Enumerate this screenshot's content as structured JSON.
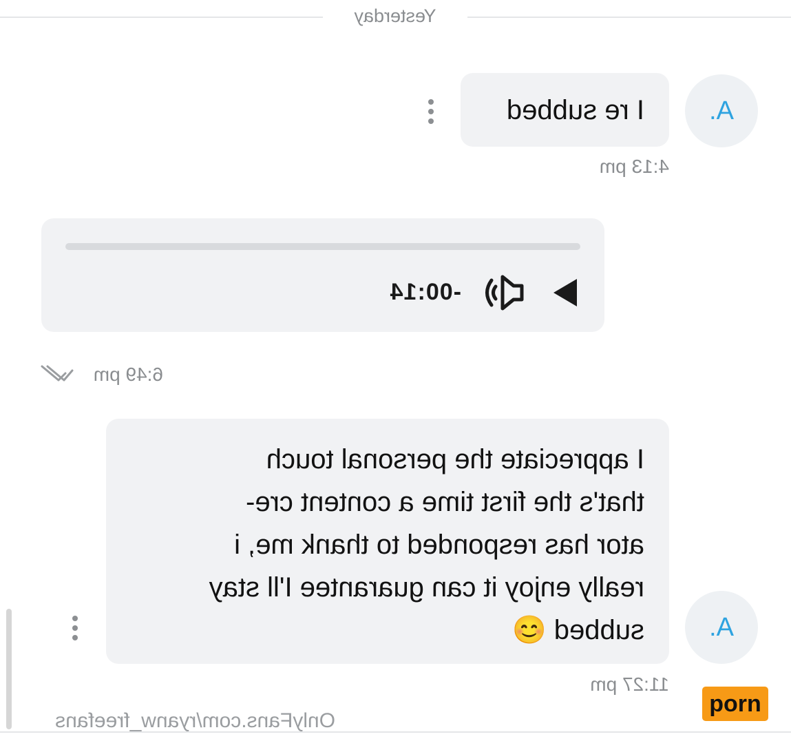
{
  "divider": {
    "label": "Yesterday"
  },
  "messages": [
    {
      "avatar": "A.",
      "text": "I re subbed",
      "time": "4:13 pm"
    },
    {
      "type": "audio",
      "remaining": "-00:14",
      "time": "6:49 pm"
    },
    {
      "avatar": "A.",
      "text": "I appreciate the personal touch that's the first time a content cre- ator has responded to thank me, i really enjoy it can guarantee I'll stay subbed 😊",
      "lines": [
        "I appreciate the personal touch",
        "that's the first time a content cre-",
        "ator has responded to thank me, i",
        "really enjoy it can guarantee I'll stay",
        "subbed 😊"
      ],
      "time": "11:27 pm"
    }
  ],
  "watermark": "OnlyFans.com/ryanw_freefans",
  "badge": "porn",
  "colors": {
    "accent": "#2ea3e0",
    "bubble": "#f1f2f4",
    "badge": "#f79a16"
  },
  "icons": [
    "more-vert-icon",
    "play-icon",
    "volume-icon",
    "double-check-icon"
  ]
}
